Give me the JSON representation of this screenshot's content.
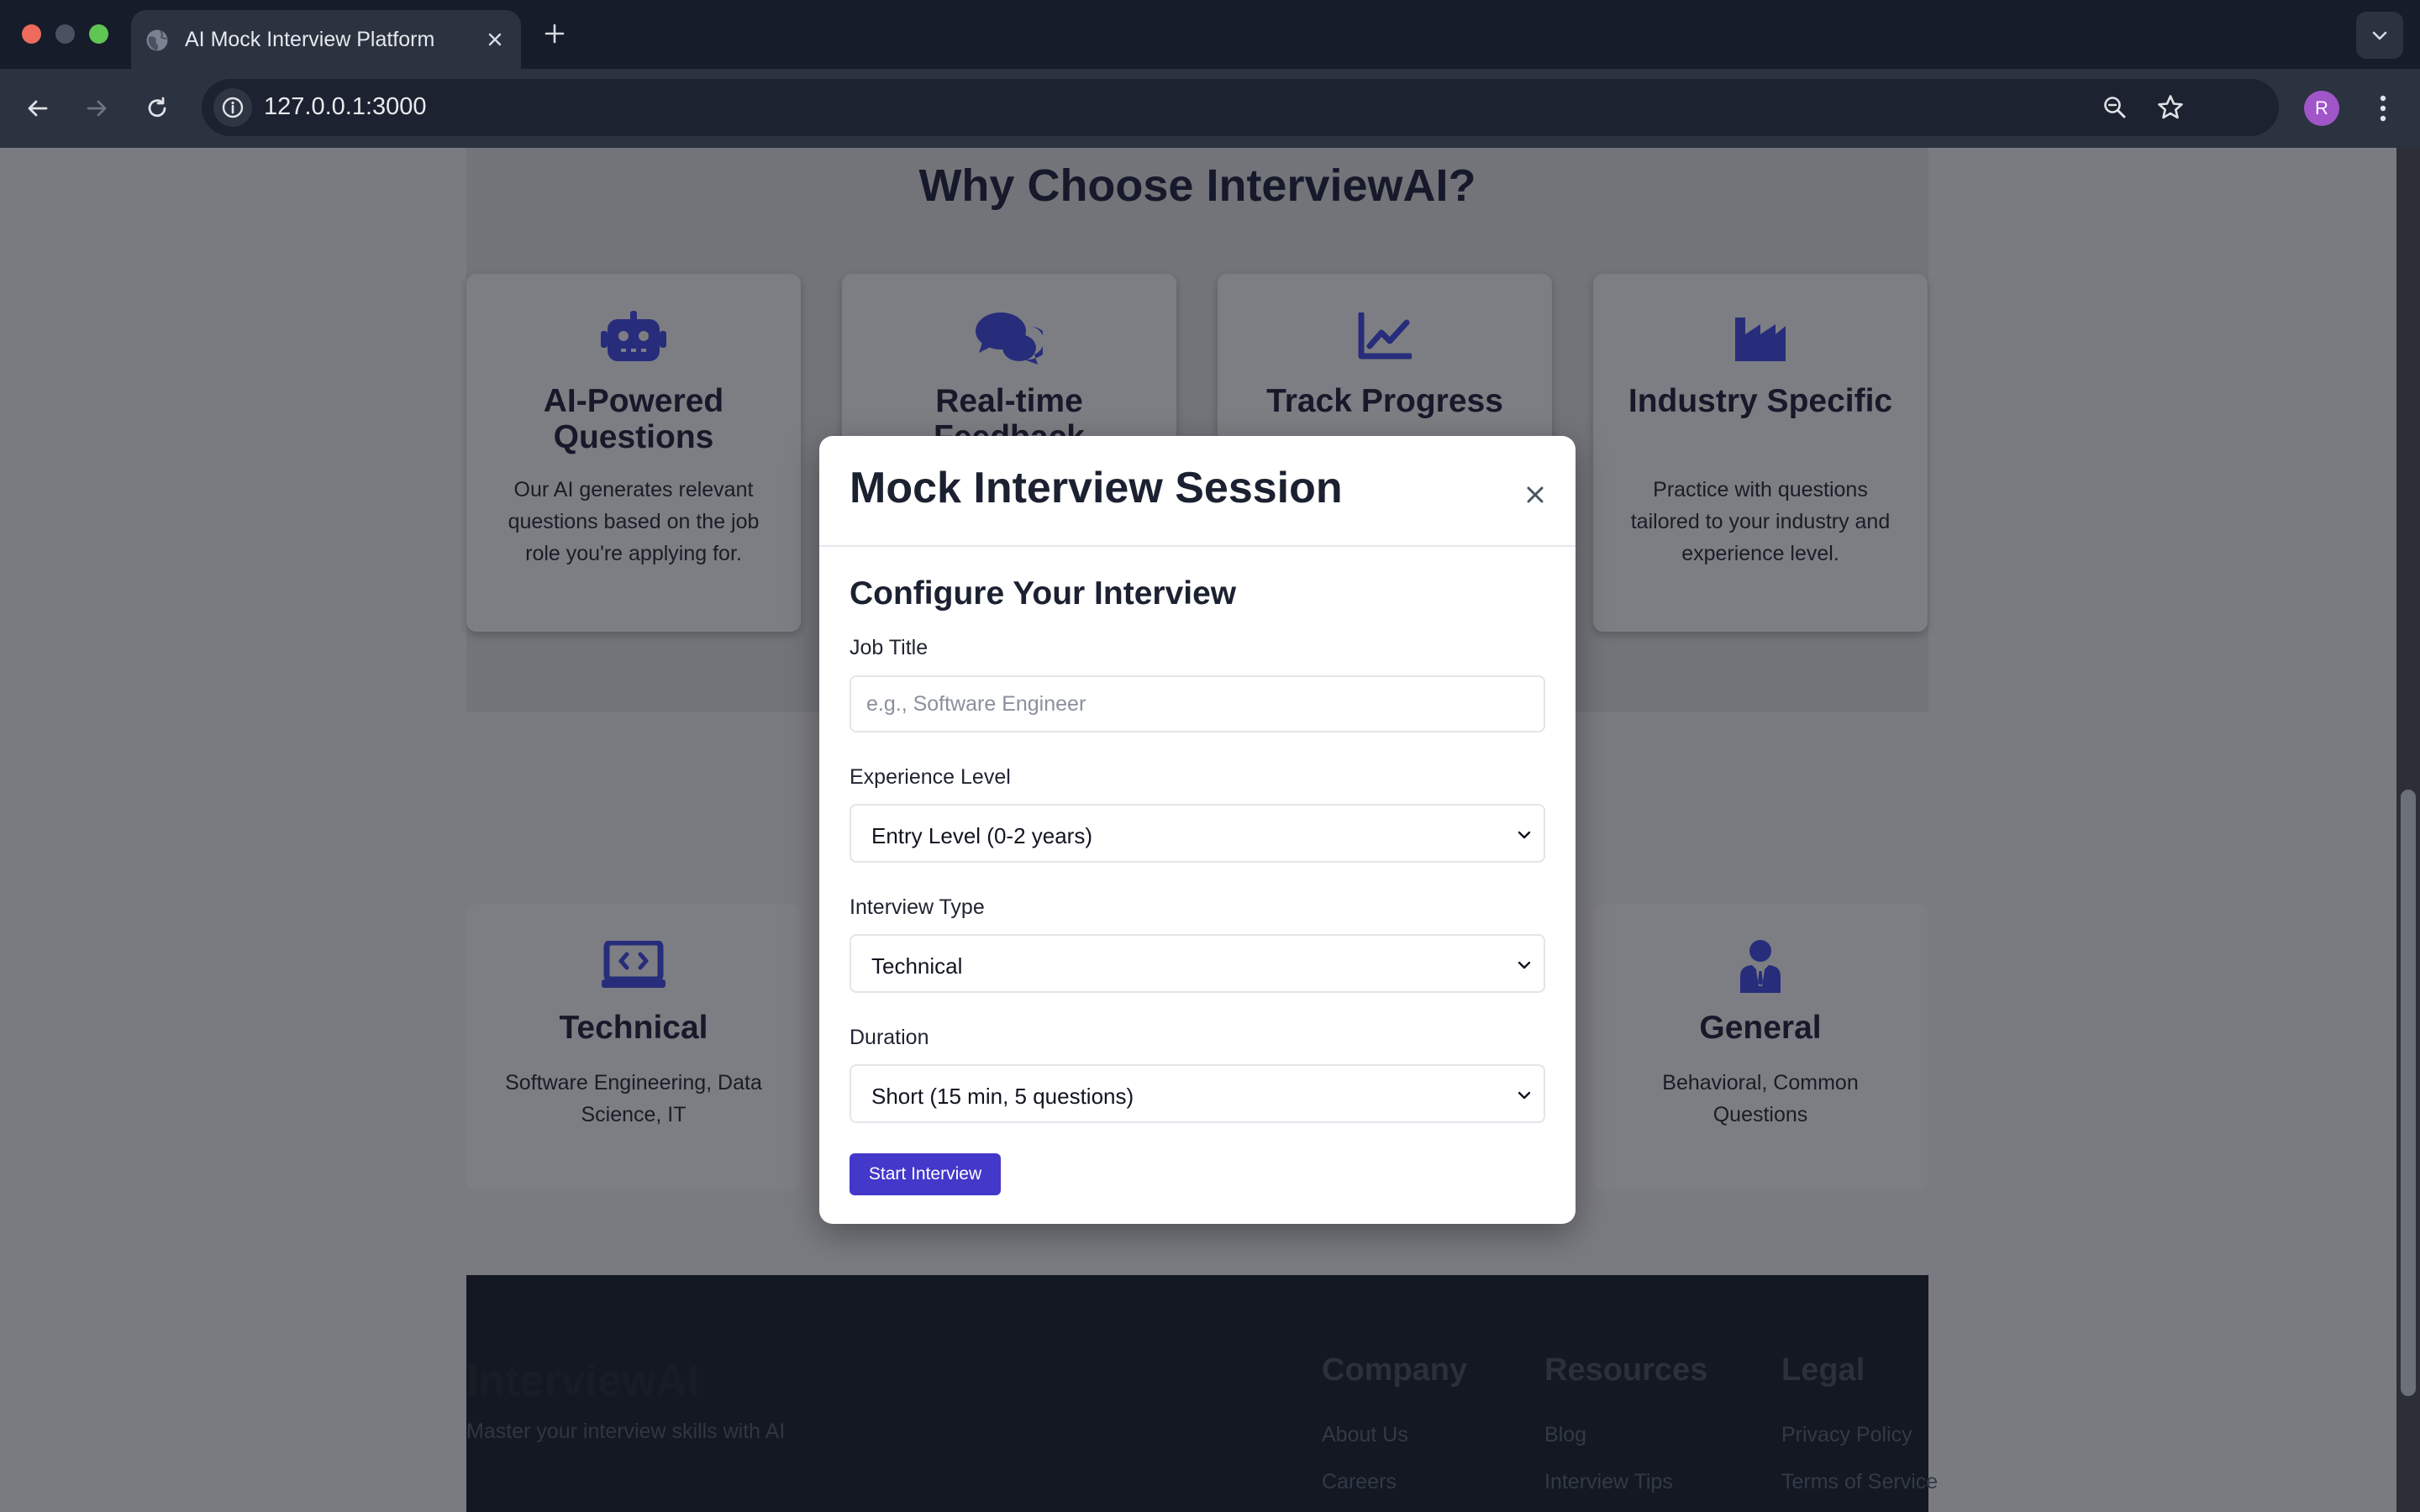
{
  "browser": {
    "tab_title": "AI Mock Interview Platform",
    "url": "127.0.0.1:3000",
    "profile_initial": "R"
  },
  "page": {
    "section_title": "Why Choose InterviewAI?",
    "features": [
      {
        "title": "AI-Powered Questions",
        "description": "Our AI generates relevant questions based on the job role you're applying for.",
        "icon": "robot-icon"
      },
      {
        "title": "Real-time Feedback",
        "description": "",
        "icon": "comments-icon"
      },
      {
        "title": "Track Progress",
        "description": "",
        "icon": "chart-line-icon"
      },
      {
        "title": "Industry Specific",
        "description": "Practice with questions tailored to your industry and experience level.",
        "icon": "industry-icon"
      }
    ],
    "interview_types": [
      {
        "title": "Technical",
        "description": "Software Engineering, Data Science, IT",
        "icon": "laptop-code-icon"
      },
      {
        "title": "General",
        "description": "Behavioral, Common Questions",
        "icon": "user-tie-icon"
      }
    ],
    "footer": {
      "brand": "InterviewAI",
      "tagline": "Master your interview skills with AI",
      "columns": [
        {
          "title": "Company",
          "links": [
            "About Us",
            "Careers"
          ]
        },
        {
          "title": "Resources",
          "links": [
            "Blog",
            "Interview Tips"
          ]
        },
        {
          "title": "Legal",
          "links": [
            "Privacy Policy",
            "Terms of Service"
          ]
        }
      ]
    }
  },
  "modal": {
    "title": "Mock Interview Session",
    "form_heading": "Configure Your Interview",
    "job_title": {
      "label": "Job Title",
      "placeholder": "e.g., Software Engineer",
      "value": ""
    },
    "experience": {
      "label": "Experience Level",
      "value": "Entry Level (0-2 years)"
    },
    "interview_type": {
      "label": "Interview Type",
      "value": "Technical"
    },
    "duration": {
      "label": "Duration",
      "value": "Short (15 min, 5 questions)"
    },
    "start_label": "Start Interview"
  },
  "colors": {
    "accent": "#4338ca",
    "icon_blue": "#272d7a",
    "overlay_page": "#7a7b80",
    "footer_bg": "#131822"
  }
}
